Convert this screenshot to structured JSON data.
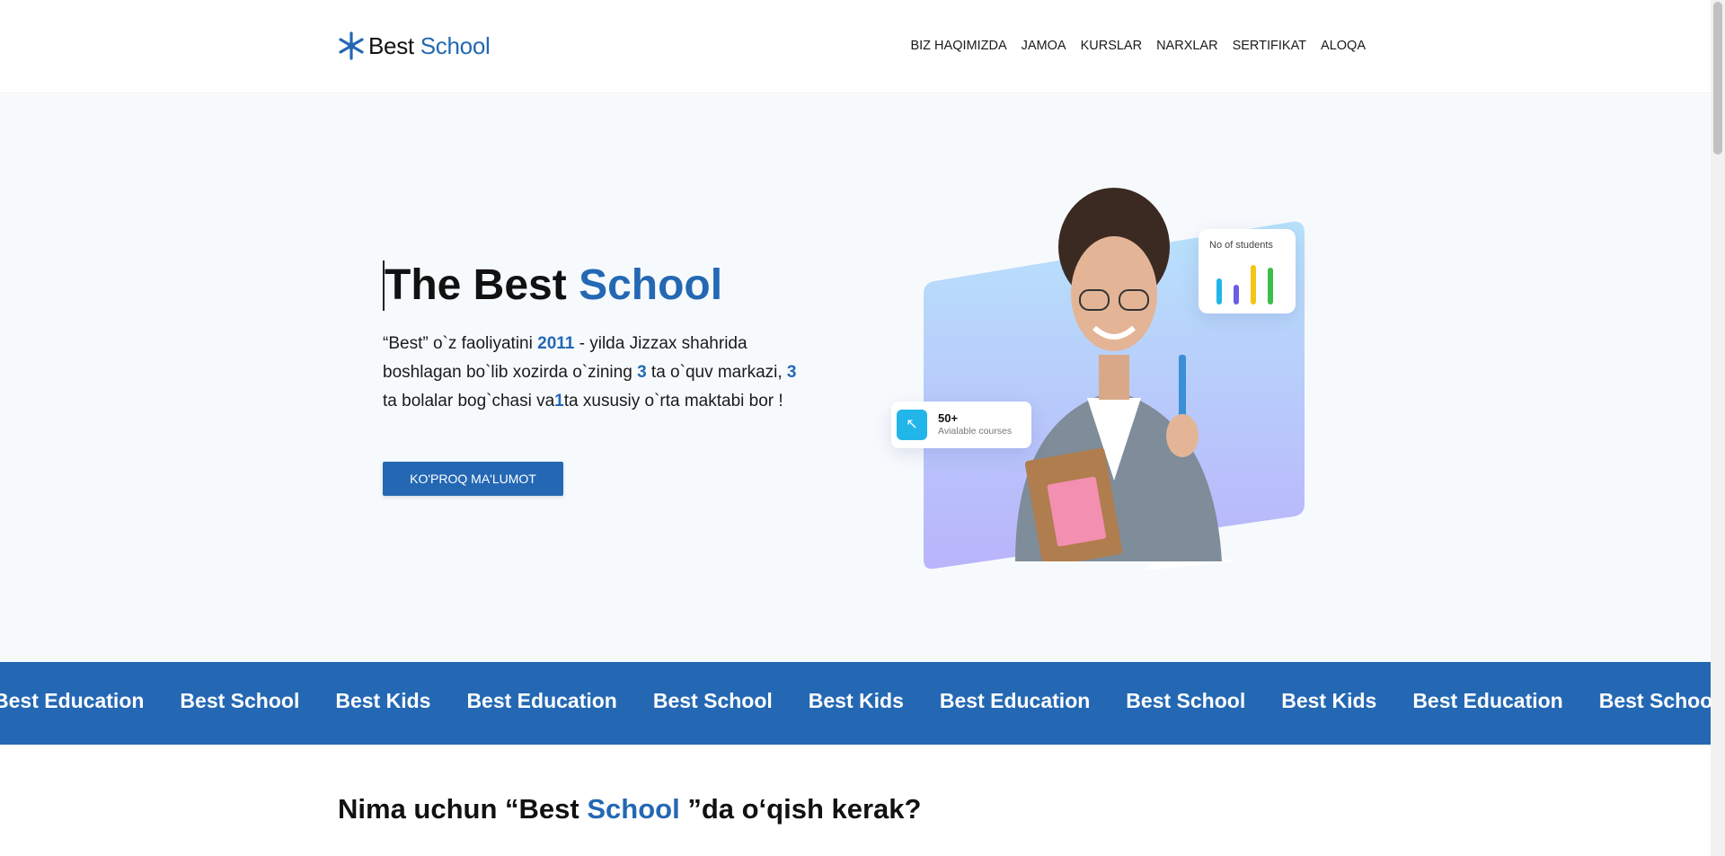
{
  "header": {
    "logo_word1": "Best",
    "logo_word2": "School",
    "nav": [
      "BIZ HAQIMIZDA",
      "JAMOA",
      "KURSLAR",
      "NARXLAR",
      "SERTIFIKAT",
      "ALOQA"
    ]
  },
  "hero": {
    "title_part1": "The Best",
    "title_part2": "School",
    "desc_1": "“Best” o`z faoliyatini ",
    "desc_year": "2011",
    "desc_2": " - yilda Jizzax shahrida boshlagan bo`lib xozirda o`zining ",
    "desc_n1": "3",
    "desc_3": " ta o`quv markazi, ",
    "desc_n2": "3",
    "desc_4": " ta bolalar bog`chasi va",
    "desc_n3": "1",
    "desc_5": "ta xususiy o`rta maktabi bor !",
    "button_label": "KO'PROQ MA'LUMOT",
    "stat_card_label": "No of students",
    "courses_count": "50+",
    "courses_label": "Avialable courses"
  },
  "marquee": {
    "items": [
      "Best Education",
      "Best School",
      "Best Kids",
      "Best Education",
      "Best School",
      "Best Kids",
      "Best Education",
      "Best School",
      "Best Kids",
      "Best Education",
      "Best School"
    ]
  },
  "section": {
    "title_part1": "Nima uchun “Best",
    "title_part2": "School",
    "title_part3": "”da o‘qish kerak?"
  },
  "colors": {
    "brand": "#2468b4",
    "bar_colors": [
      "#21b5ea",
      "#6c5ce7",
      "#f5c518",
      "#3bbf4a"
    ]
  },
  "stat_bars": [
    0.55,
    0.42,
    0.85,
    0.78
  ]
}
